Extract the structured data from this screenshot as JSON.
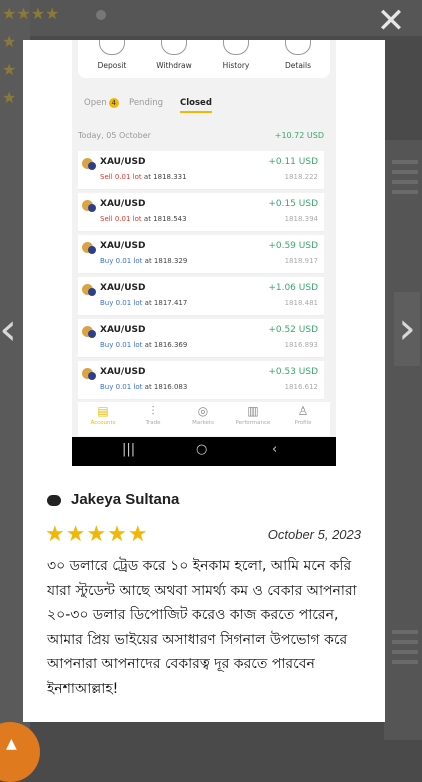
{
  "modal": {
    "close_icon": "x-icon",
    "prev_icon": "chevron-left-icon",
    "next_icon": "chevron-right-icon"
  },
  "trading_app": {
    "top_actions": [
      "Deposit",
      "Withdraw",
      "History",
      "Details"
    ],
    "tabs": {
      "open_label": "Open",
      "open_count": "4",
      "pending_label": "Pending",
      "closed_label": "Closed"
    },
    "summary": {
      "date_label": "Today, 05 October",
      "total": "+10.72 USD"
    },
    "trades": [
      {
        "symbol": "XAU/USD",
        "side": "Sell",
        "lot": "0.01 lot",
        "at": "at 1818.331",
        "pnl": "+0.11 USD",
        "close": "1818.222"
      },
      {
        "symbol": "XAU/USD",
        "side": "Sell",
        "lot": "0.01 lot",
        "at": "at 1818.543",
        "pnl": "+0.15 USD",
        "close": "1818.394"
      },
      {
        "symbol": "XAU/USD",
        "side": "Buy",
        "lot": "0.01 lot",
        "at": "at 1818.329",
        "pnl": "+0.59 USD",
        "close": "1818.917"
      },
      {
        "symbol": "XAU/USD",
        "side": "Buy",
        "lot": "0.01 lot",
        "at": "at 1817.417",
        "pnl": "+1.06 USD",
        "close": "1818.481"
      },
      {
        "symbol": "XAU/USD",
        "side": "Buy",
        "lot": "0.01 lot",
        "at": "at 1816.369",
        "pnl": "+0.52 USD",
        "close": "1816.893"
      },
      {
        "symbol": "XAU/USD",
        "side": "Buy",
        "lot": "0.01 lot",
        "at": "at 1816.083",
        "pnl": "+0.53 USD",
        "close": "1816.612"
      }
    ],
    "bottom_nav": [
      "Accounts",
      "Trade",
      "Markets",
      "Performance",
      "Profile"
    ]
  },
  "review": {
    "reviewer_name": "Jakeya Sultana",
    "stars": "★★★★★",
    "rating": 5,
    "date": "October 5, 2023",
    "text": "৩০ ডলারে ট্রেড করে ১০ ইনকাম হলো, আমি মনে করি যারা স্টুডেন্ট আছে অথবা সামর্থ্য কম ও বেকার আপনারা ২০-৩০ ডলার ডিপোজিট করেও কাজ করতে পারেন, আমার প্রিয় ভাইয়ের অসাধারণ সিগনাল উপভোগ করে আপনারা আপনাদের বেকারত্ব দূর করতে পারবেন ইনশাআল্লাহ!"
  },
  "colors": {
    "accent": "#f2b705",
    "profit": "#3aa86b",
    "sell": "#d9362b",
    "buy": "#3a6fd8"
  }
}
